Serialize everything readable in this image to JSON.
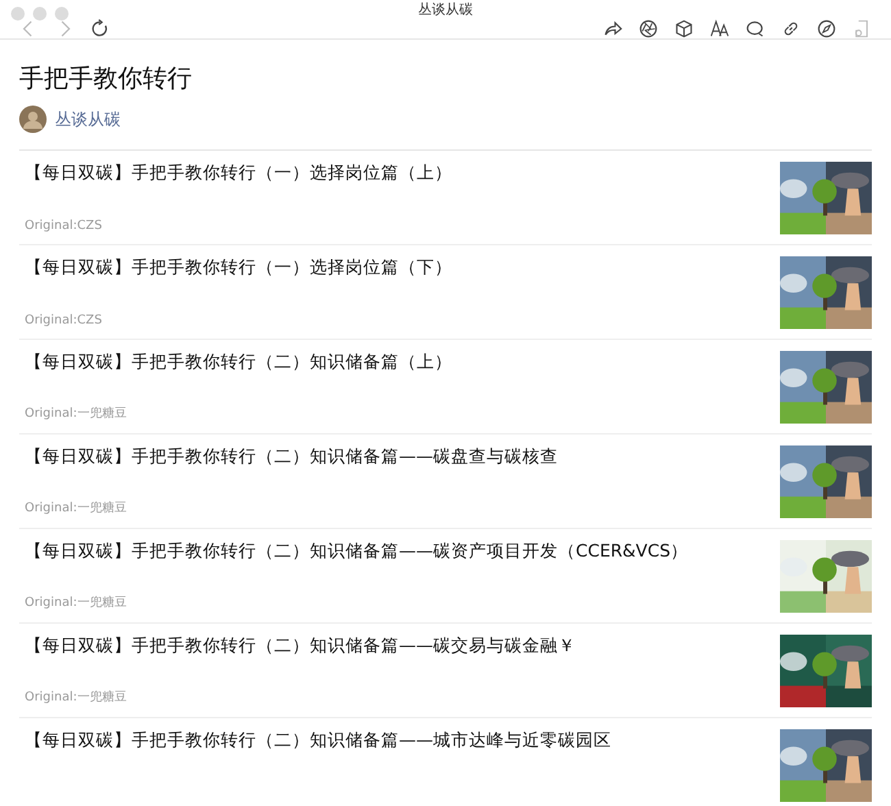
{
  "window": {
    "title": "丛谈从碳"
  },
  "article": {
    "title": "手把手教你转行",
    "author": "丛谈从碳"
  },
  "items": [
    {
      "title": "【每日双碳】手把手教你转行（一）选择岗位篇（上）",
      "source": "Original:CZS"
    },
    {
      "title": "【每日双碳】手把手教你转行（一）选择岗位篇（下）",
      "source": "Original:CZS"
    },
    {
      "title": "【每日双碳】手把手教你转行（二）知识储备篇（上）",
      "source": "Original:一兜糖豆"
    },
    {
      "title": "【每日双碳】手把手教你转行（二）知识储备篇——碳盘查与碳核查",
      "source": "Original:一兜糖豆"
    },
    {
      "title": "【每日双碳】手把手教你转行（二）知识储备篇——碳资产项目开发（CCER&VCS）",
      "source": "Original:一兜糖豆"
    },
    {
      "title": "【每日双碳】手把手教你转行（二）知识储备篇——碳交易与碳金融￥",
      "source": "Original:一兜糖豆"
    },
    {
      "title": "【每日双碳】手把手教你转行（二）知识储备篇——城市达峰与近零碳园区"
    }
  ]
}
